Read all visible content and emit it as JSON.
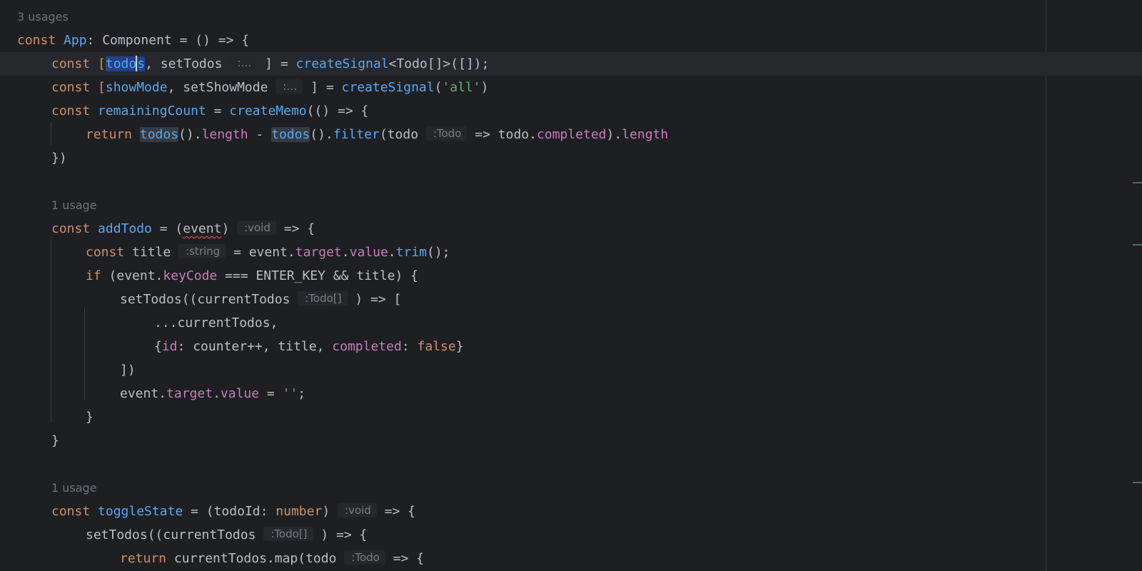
{
  "editor": {
    "inlay_hints": {
      "type_todo": ":Todo",
      "type_void": ":void",
      "type_string": ":string",
      "type_todo_array": ":Todo[]",
      "collapsed": ":…"
    },
    "usages": {
      "app": "3 usages",
      "add_todo": "1 usage",
      "toggle_state": "1 usage"
    },
    "code": {
      "l1": {
        "const": "const ",
        "name": "App",
        "rest": ": Component = () => {"
      },
      "l2": {
        "a": "const [",
        "sel_start": "todo",
        "sel_end": "s",
        "b": ", setTodos ",
        "c": " ] = ",
        "fn": "createSignal",
        "d": "<Todo[]>([]);"
      },
      "l3": {
        "a": "const [",
        "var": "showMode",
        "b": ", setShowMode ",
        "c": " ] = ",
        "fn": "createSignal",
        "d": "(",
        "str": "'all'",
        "e": ")"
      },
      "l4": {
        "a": "const ",
        "var": "remainingCount",
        "b": " = ",
        "fn": "createMemo",
        "c": "(() => {"
      },
      "l5": {
        "kw": "return ",
        "t1": "todos",
        "a": "().",
        "p1": "length",
        "b": " - ",
        "t2": "todos",
        "c": "().",
        "fn": "filter",
        "d": "(todo ",
        "e": " => todo.",
        "p2": "completed",
        "f": ").",
        "p3": "length"
      },
      "l6": {
        "a": "})"
      },
      "l8": {
        "a": "const ",
        "var": "addTodo",
        "b": " = (",
        "param": "event",
        "c": ") ",
        "d": " => {"
      },
      "l9": {
        "a": "const ",
        "b": "title ",
        "c": " = event.",
        "p1": "target",
        "d": ".",
        "p2": "value",
        "e": ".",
        "fn": "trim",
        "f": "();"
      },
      "l10": {
        "kw": "if",
        "a": " (event.",
        "p": "keyCode",
        "b": " === ENTER_KEY && title) {"
      },
      "l11": {
        "a": "setTodos((currentTodos ",
        "b": " ) => ["
      },
      "l12": {
        "a": "...currentTodos,"
      },
      "l13": {
        "a": "{",
        "p1": "id",
        "b": ": counter++, title, ",
        "p2": "completed",
        "c": ": ",
        "kw": "false",
        "d": "}"
      },
      "l14": {
        "a": "])"
      },
      "l15": {
        "a": "event.",
        "p1": "target",
        "b": ".",
        "p2": "value",
        "c": " = ",
        "str": "''",
        "d": ";"
      },
      "l16": {
        "a": "}"
      },
      "l17": {
        "a": "}"
      },
      "l19": {
        "a": "const ",
        "var": "toggleState",
        "b": " = (todoId: ",
        "ty": "number",
        "c": ") ",
        "d": " => {"
      },
      "l20": {
        "a": "setTodos((currentTodos ",
        "b": " ) => {"
      },
      "l21": {
        "kw": "return ",
        "a": "currentTodos.map(todo ",
        "b": " => {"
      }
    },
    "colors": {
      "background": "#1e1f22",
      "keyword": "#cf8e6d",
      "function": "#56a8f5",
      "property": "#c77dbb",
      "string": "#6aab73",
      "selection": "#214283"
    }
  }
}
